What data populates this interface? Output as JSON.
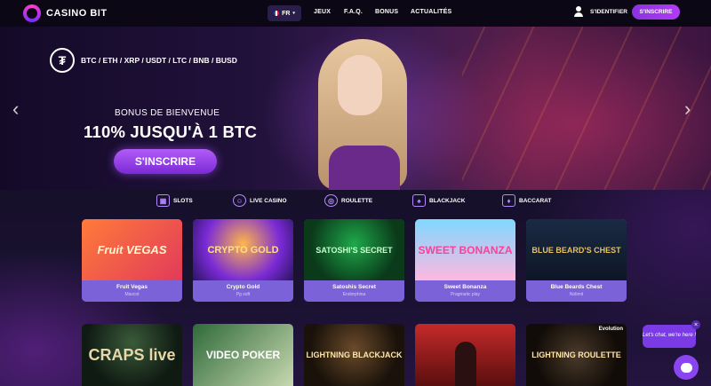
{
  "header": {
    "brand": "CASINO BIT",
    "language": "FR",
    "nav": [
      "JEUX",
      "F.A.Q.",
      "BONUS",
      "ACTUALITÉS"
    ],
    "signin_label": "S'IDENTIFIER",
    "signup_label": "S'INSCRIRE"
  },
  "hero": {
    "currencies": "BTC / ETH / XRP / USDT / LTC / BNB / BUSD",
    "bonus_title": "BONUS DE BIENVENUE",
    "bonus_amount": "110% JUSQU'À 1 BTC",
    "cta_label": "S'INSCRIRE",
    "tether_symbol": "₮"
  },
  "categories": [
    {
      "label": "SLOTS",
      "icon": "slots-icon"
    },
    {
      "label": "LIVE CASINO",
      "icon": "dealer-icon"
    },
    {
      "label": "ROULETTE",
      "icon": "roulette-icon"
    },
    {
      "label": "BLACKJACK",
      "icon": "cards-icon"
    },
    {
      "label": "BACCARAT",
      "icon": "baccarat-icon"
    }
  ],
  "games_row1": [
    {
      "name": "Fruit Vegas",
      "provider": "Mascot",
      "art": "Fruit VEGAS"
    },
    {
      "name": "Crypto Gold",
      "provider": "Pg soft",
      "art": "CRYPTO GOLD"
    },
    {
      "name": "Satoshis Secret",
      "provider": "Endorphina",
      "art": "SATOSHI'S SECRET"
    },
    {
      "name": "Sweet Bonanza",
      "provider": "Pragmatic play",
      "art": "SWEET BONANZA"
    },
    {
      "name": "Blue Beards Chest",
      "provider": "Nolimit",
      "art": "BLUE BEARD'S CHEST"
    }
  ],
  "games_row2": [
    {
      "art": "CRAPS live"
    },
    {
      "art": "VIDEO POKER"
    },
    {
      "art": "LIGHTNING BLACKJACK"
    },
    {
      "art": ""
    },
    {
      "art": "LIGHTNING ROULETTE",
      "badge": "Evolution"
    }
  ],
  "chat": {
    "bubble_text": "Let's chat, we're here !",
    "close_label": "×"
  },
  "colors": {
    "accent": "#8a32e0",
    "card": "#7b62d8",
    "background": "#100a1c"
  }
}
